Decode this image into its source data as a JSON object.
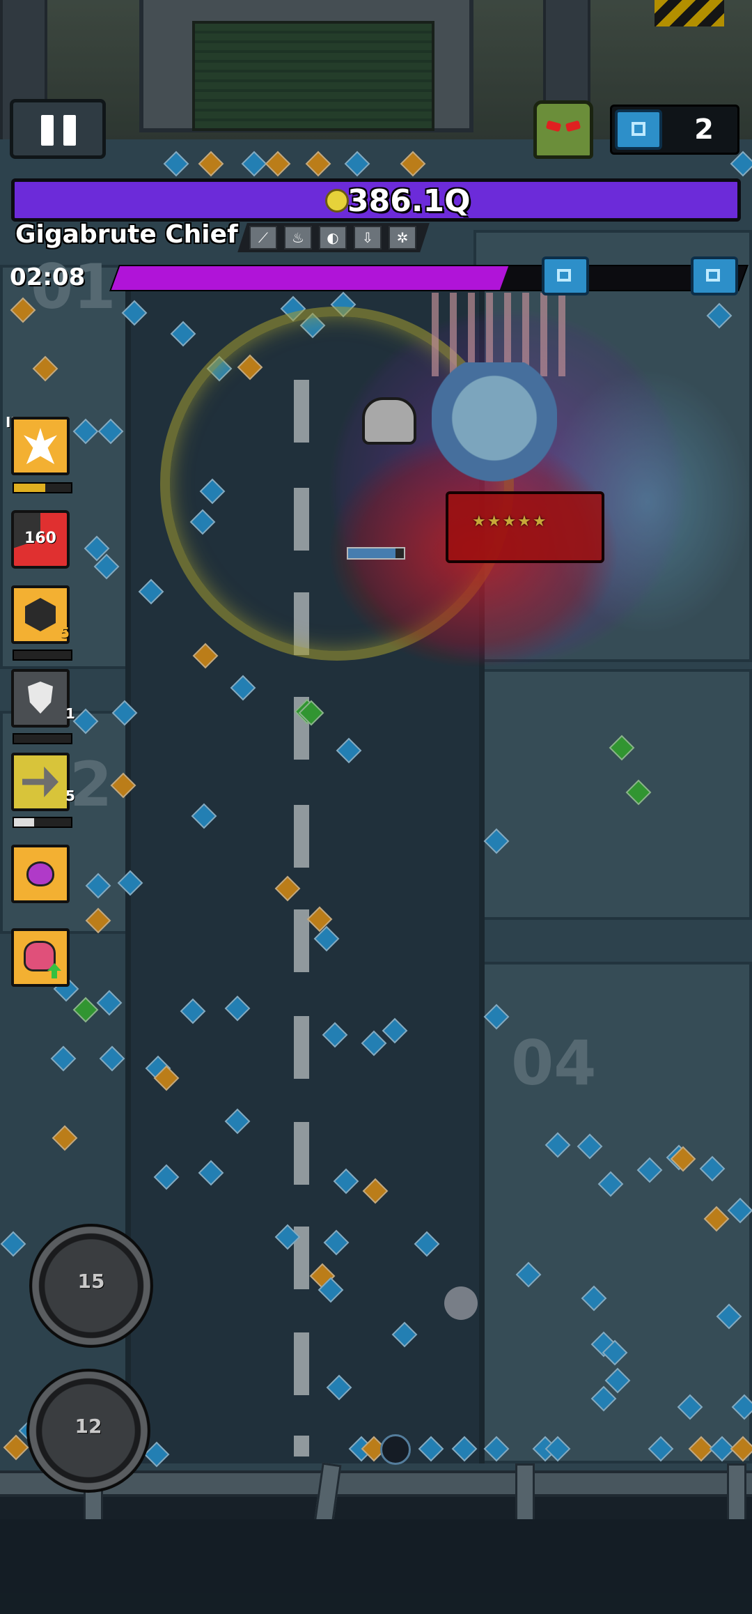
{
  "hud": {
    "pause_label": "Pause",
    "chest_count": "2",
    "boss_hp": "386.1Q",
    "boss_name": "Gigabrute Chief",
    "boss_traits": [
      "claw-icon",
      "flame-icon",
      "shield-icon",
      "arrow-down-icon",
      "gear-icon"
    ],
    "timer": "02:08",
    "wave_progress": 0.62
  },
  "arena": {
    "bay_numbers": [
      "01",
      "2",
      "04"
    ]
  },
  "skills": {
    "tier_label": "II",
    "slot1_icon": "burst-icon",
    "slot2_cooldown": "160",
    "slot3_count": "5",
    "slot4_count": "1",
    "slot5_count": "5",
    "slot6_icon": "cat-pet-icon",
    "slot7_icon": "upgrade-monster-icon"
  },
  "abilities": {
    "ultimate_1_count": "15",
    "ultimate_2_count": "12"
  },
  "colors": {
    "boss_hp": "#6c2bd9",
    "wave_fill": "#b014d8",
    "gem_blue": "#2ea3e6",
    "gem_orange": "#f0a020",
    "gem_green": "#3fbf3f",
    "damage": "#c81414"
  }
}
